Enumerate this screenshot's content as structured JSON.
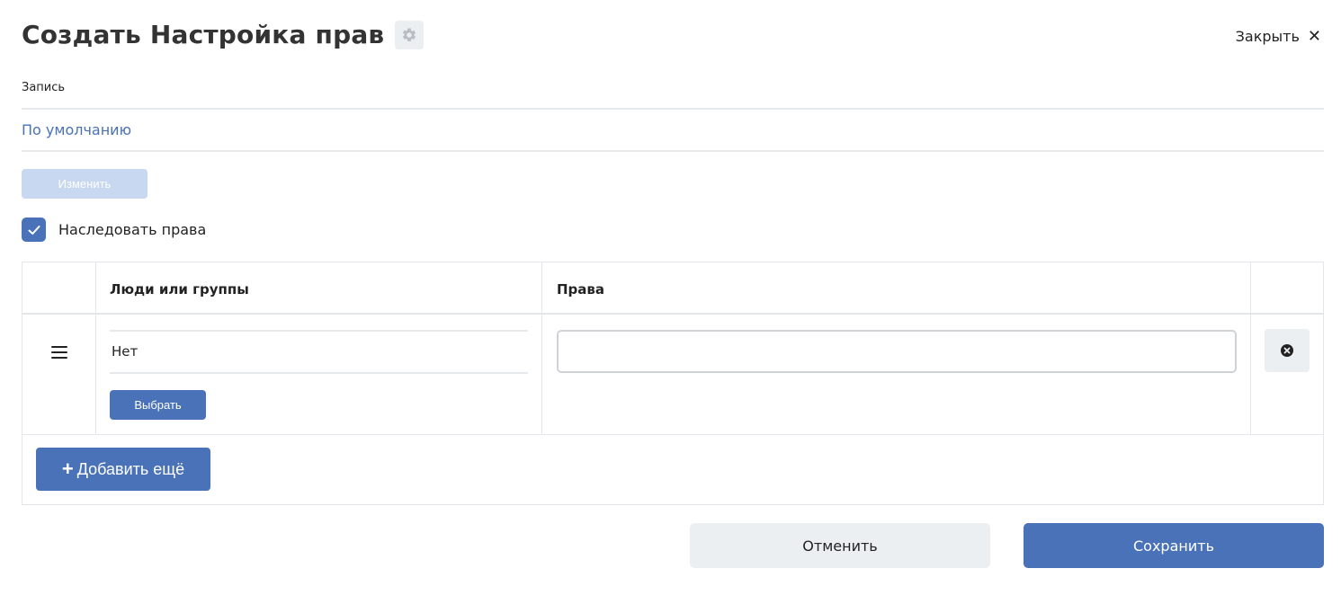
{
  "header": {
    "title": "Создать Настройка прав",
    "settings_icon": "gear-icon",
    "close_label": "Закрыть",
    "close_glyph": "✕"
  },
  "record": {
    "label": "Запись",
    "value": "По умолчанию",
    "change_button": "Изменить"
  },
  "inherit": {
    "label": "Наследовать права",
    "checked": true
  },
  "table": {
    "columns": [
      "",
      "Люди или группы",
      "Права",
      ""
    ],
    "rows": [
      {
        "people_value": "Нет",
        "choose_button": "Выбрать",
        "rights_value": ""
      }
    ],
    "add_button": "Добавить ещё",
    "add_glyph": "+"
  },
  "footer": {
    "cancel_label": "Отменить",
    "save_label": "Сохранить"
  },
  "colors": {
    "primary": "#4a72b8",
    "primary_disabled": "#c8d8f0",
    "link": "#4a72b8",
    "secondary_bg": "#eceff2",
    "border": "#e3e6ea"
  }
}
